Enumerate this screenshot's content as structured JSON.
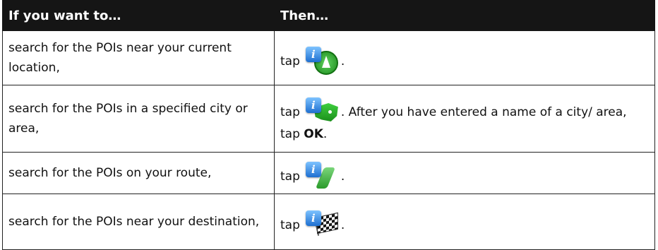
{
  "header": {
    "col1": "If you want to…",
    "col2": "Then…"
  },
  "rows": [
    {
      "condition": "search for the POIs near your current location,",
      "tap": "tap",
      "icon": "poi-near-current-location-icon",
      "after": "."
    },
    {
      "condition": "search for the POIs in a specified city or area,",
      "tap": "tap",
      "icon": "poi-in-city-map-icon",
      "after": ". After you have entered a name of a city/ area, tap ",
      "bold": "OK",
      "end": "."
    },
    {
      "condition": "search for the POIs on your route,",
      "tap": "tap",
      "icon": "poi-on-route-icon",
      "after": "."
    },
    {
      "condition": "search for the POIs near your destination,",
      "tap": "tap",
      "icon": "poi-near-destination-flag-icon",
      "after": "."
    }
  ],
  "colors": {
    "header_bg": "#151515",
    "header_text": "#ffffff",
    "border": "#222222",
    "icon_green": "#2a9a2a",
    "icon_blue": "#1e6fd0"
  }
}
